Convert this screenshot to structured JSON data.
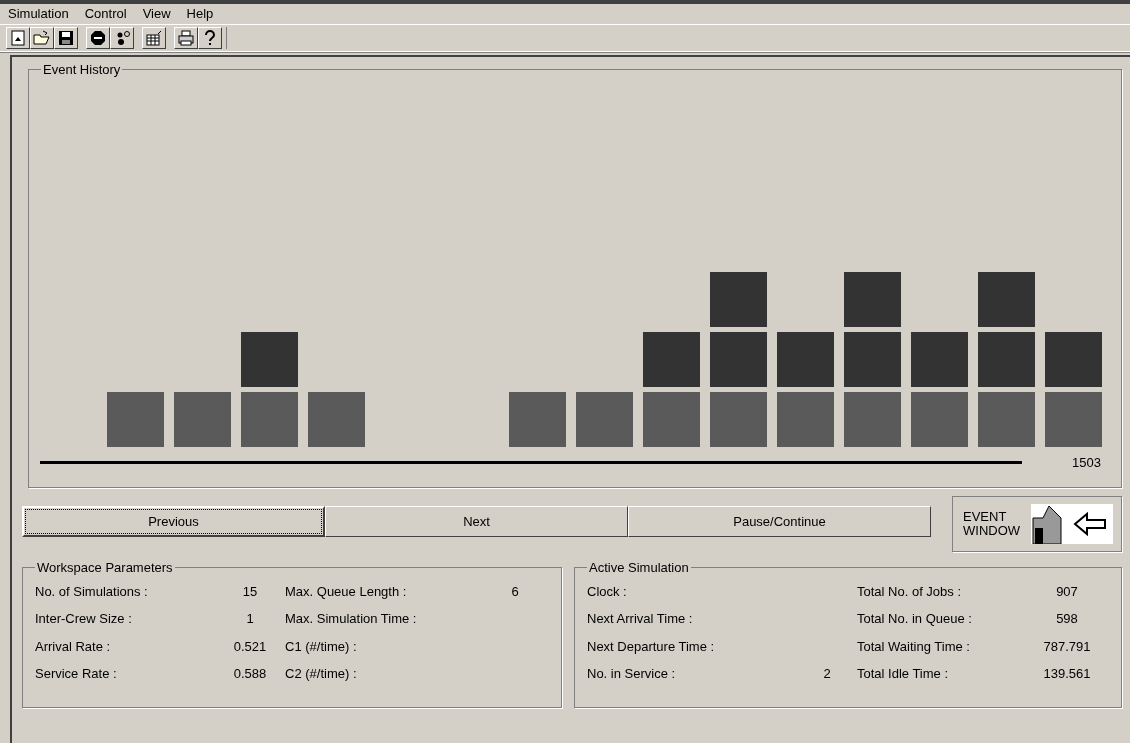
{
  "menu": [
    "Simulation",
    "Control",
    "View",
    "Help"
  ],
  "toolbar": [
    {
      "kind": "new"
    },
    {
      "kind": "open"
    },
    {
      "kind": "save"
    },
    {
      "kind": "sep"
    },
    {
      "kind": "stop"
    },
    {
      "kind": "add"
    },
    {
      "kind": "sep"
    },
    {
      "kind": "table"
    },
    {
      "kind": "sep"
    },
    {
      "kind": "print"
    },
    {
      "kind": "help"
    }
  ],
  "event_history": {
    "title": "Event History",
    "end_label": "1503",
    "columns": [
      {
        "blocks": [
          {
            "kind": "light"
          }
        ]
      },
      {
        "blocks": [
          {
            "kind": "light"
          }
        ]
      },
      {
        "blocks": [
          {
            "kind": "light"
          },
          {
            "kind": "dark"
          }
        ]
      },
      {
        "blocks": [
          {
            "kind": "light"
          }
        ]
      },
      {},
      {},
      {
        "blocks": [
          {
            "kind": "light"
          }
        ]
      },
      {
        "blocks": [
          {
            "kind": "light"
          }
        ]
      },
      {
        "blocks": [
          {
            "kind": "light"
          },
          {
            "kind": "dark"
          }
        ]
      },
      {
        "blocks": [
          {
            "kind": "light"
          },
          {
            "kind": "dark"
          },
          {
            "kind": "dark"
          }
        ]
      },
      {
        "blocks": [
          {
            "kind": "light"
          },
          {
            "kind": "dark"
          }
        ]
      },
      {
        "blocks": [
          {
            "kind": "light"
          },
          {
            "kind": "dark"
          },
          {
            "kind": "dark"
          }
        ]
      },
      {
        "blocks": [
          {
            "kind": "light"
          },
          {
            "kind": "dark"
          }
        ]
      },
      {
        "blocks": [
          {
            "kind": "light"
          },
          {
            "kind": "dark"
          },
          {
            "kind": "dark"
          }
        ]
      },
      {
        "blocks": [
          {
            "kind": "light"
          },
          {
            "kind": "dark"
          }
        ]
      }
    ]
  },
  "buttons": [
    {
      "label": "Previous",
      "focused": true
    },
    {
      "label": "Next",
      "focused": false
    },
    {
      "label": "Pause/Continue",
      "focused": false
    }
  ],
  "event_window": {
    "label": "EVENT WINDOW"
  },
  "workspace": {
    "title": "Workspace Parameters",
    "rows": [
      {
        "label": "No. of Simulations :",
        "value": "15",
        "label_2": "Max. Queue Length :",
        "value_2": "6"
      },
      {
        "label": "Inter-Crew Size :",
        "value": "1",
        "label_2": "Max. Simulation Time :"
      },
      {
        "label": "Arrival Rate :",
        "value": "0.521",
        "label_2": "C1 (#/time) :"
      },
      {
        "label": "Service Rate :",
        "value": "0.588",
        "label_2": "C2 (#/time) :"
      }
    ]
  },
  "active": {
    "title": "Active Simulation",
    "rows": [
      {
        "label": "Clock :",
        "label_2": "Total No. of Jobs :",
        "value_2": "907"
      },
      {
        "label": "Next Arrival Time :",
        "label_2": "Total No. in Queue :",
        "value_2": "598"
      },
      {
        "label": "Next Departure Time :",
        "label_2": "Total Waiting Time :",
        "value_2": "787.791"
      },
      {
        "label": "No. in Service :",
        "value": "2",
        "label_2": "Total Idle Time :",
        "value_2": "139.561"
      }
    ]
  }
}
